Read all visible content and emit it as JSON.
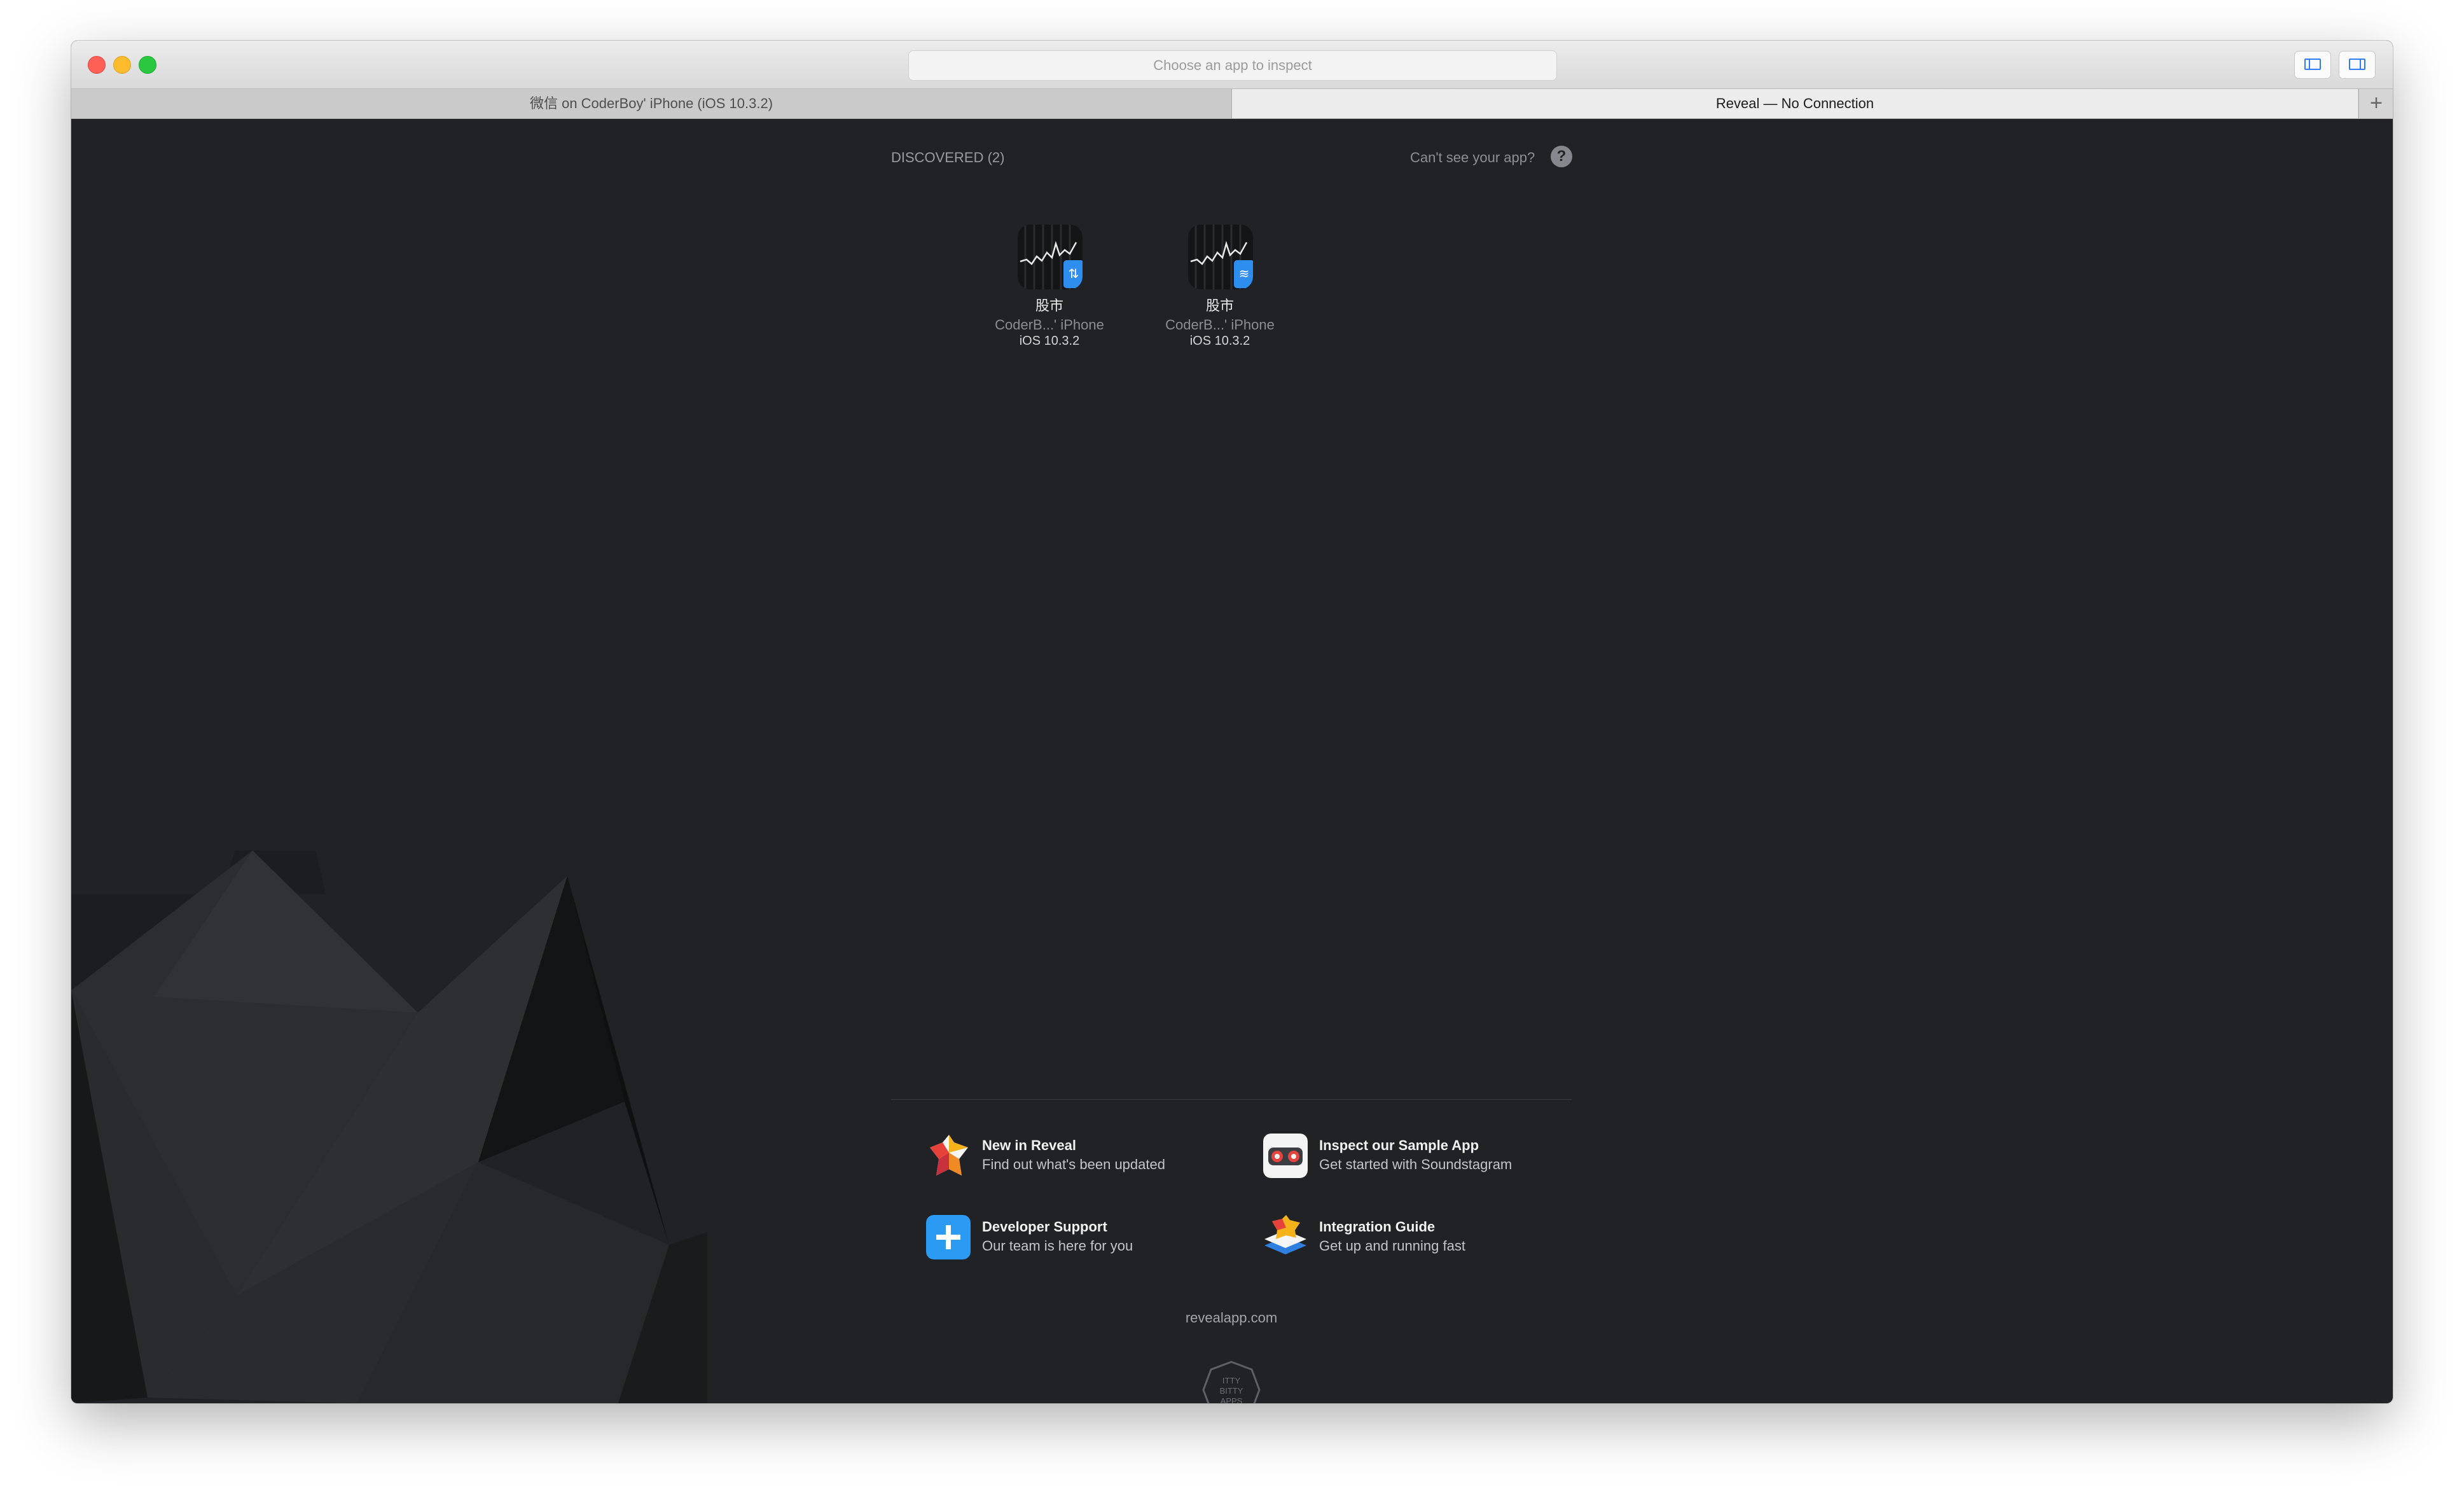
{
  "window": {
    "search_placeholder": "Choose an app to inspect"
  },
  "tabs": [
    {
      "label": "微信 on CoderBoy' iPhone (iOS 10.3.2)",
      "active": false
    },
    {
      "label": "Reveal — No Connection",
      "active": true
    }
  ],
  "tab_add_label": "+",
  "discovered": {
    "label": "DISCOVERED (2)",
    "help_text": "Can't see your app?",
    "help_icon_label": "?",
    "apps": [
      {
        "name": "股市",
        "device": "CoderB...' iPhone",
        "os": "iOS 10.3.2",
        "connection": "usb",
        "badge_glyph": "⇅"
      },
      {
        "name": "股市",
        "device": "CoderB...' iPhone",
        "os": "iOS 10.3.2",
        "connection": "wifi",
        "badge_glyph": "≋"
      }
    ]
  },
  "links": [
    {
      "title": "New in Reveal",
      "subtitle": "Find out what's been updated",
      "icon": "reveal-star-icon"
    },
    {
      "title": "Inspect our Sample App",
      "subtitle": "Get started with Soundstagram",
      "icon": "soundstagram-icon"
    },
    {
      "title": "Developer Support",
      "subtitle": "Our team is here for you",
      "icon": "plus-icon"
    },
    {
      "title": "Integration Guide",
      "subtitle": "Get up and running fast",
      "icon": "integration-guide-icon"
    }
  ],
  "footer": {
    "url": "revealapp.com",
    "logo_text": "ITTY BITTY APPS"
  },
  "colors": {
    "background": "#212225",
    "accent": "#2e8ef0"
  }
}
